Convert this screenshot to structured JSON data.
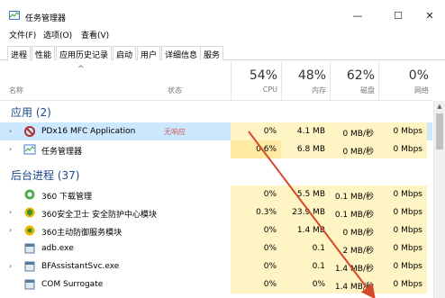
{
  "window": {
    "title": "任务管理器",
    "minimize": "—",
    "maximize": "☐",
    "close": "✕"
  },
  "menu": [
    "文件(F)",
    "选项(O)",
    "查看(V)"
  ],
  "tabs": [
    "进程",
    "性能",
    "应用历史记录",
    "启动",
    "用户",
    "详细信息",
    "服务"
  ],
  "header": {
    "name": "名称",
    "status": "状态",
    "cpu": {
      "pct": "54%",
      "label": "CPU"
    },
    "mem": {
      "pct": "48%",
      "label": "内存"
    },
    "disk": {
      "pct": "62%",
      "label": "磁盘"
    },
    "net": {
      "pct": "0%",
      "label": "网络"
    }
  },
  "colors": {
    "cpu_heat": "#fff4c4",
    "cpu_heat_strong": "#ffe9a3",
    "mem_heat": "#fff4c4",
    "selected": "#cce8ff",
    "arrow": "#d44a2c"
  },
  "sections": {
    "apps": "应用 (2)",
    "background": "后台进程 (37)"
  },
  "apps": [
    {
      "name": "PDx16 MFC Application",
      "status": "无响应",
      "cpu": "0%",
      "mem": "4.1 MB",
      "disk": "0 MB/秒",
      "net": "0 Mbps",
      "icon": "pdx-app-icon",
      "expand": "›"
    },
    {
      "name": "任务管理器",
      "status": "",
      "cpu": "0.6%",
      "mem": "6.8 MB",
      "disk": "0 MB/秒",
      "net": "0 Mbps",
      "icon": "task-manager-icon",
      "expand": "›"
    }
  ],
  "background": [
    {
      "name": "360 下载管理",
      "cpu": "0%",
      "mem": "5.5 MB",
      "disk": "0.1 MB/秒",
      "net": "0 Mbps",
      "icon": "360-download-icon",
      "expand": ""
    },
    {
      "name": "360安全卫士 安全防护中心模块",
      "cpu": "0.3%",
      "mem": "23.9 MB",
      "disk": "0.1 MB/秒",
      "net": "0 Mbps",
      "icon": "360-shield-icon",
      "expand": "›"
    },
    {
      "name": "360主动防御服务模块",
      "cpu": "0%",
      "mem": "1.4 MB",
      "disk": "0 MB/秒",
      "net": "0 Mbps",
      "icon": "360-defense-icon",
      "expand": "›"
    },
    {
      "name": "adb.exe",
      "cpu": "0%",
      "mem": "0.1",
      "disk": "2 MB/秒",
      "net": "0 Mbps",
      "icon": "adb-icon",
      "expand": ""
    },
    {
      "name": "BFAssistantSvc.exe",
      "cpu": "0%",
      "mem": "0.1",
      "disk": "1.4 MB/秒",
      "net": "0 Mbps",
      "icon": "bfassistant-icon",
      "expand": "›"
    },
    {
      "name": "COM Surrogate",
      "cpu": "0%",
      "mem": "0%",
      "disk": "1.4 MB/秒",
      "net": "0 Mbps",
      "icon": "com-surrogate-icon",
      "expand": ""
    }
  ]
}
